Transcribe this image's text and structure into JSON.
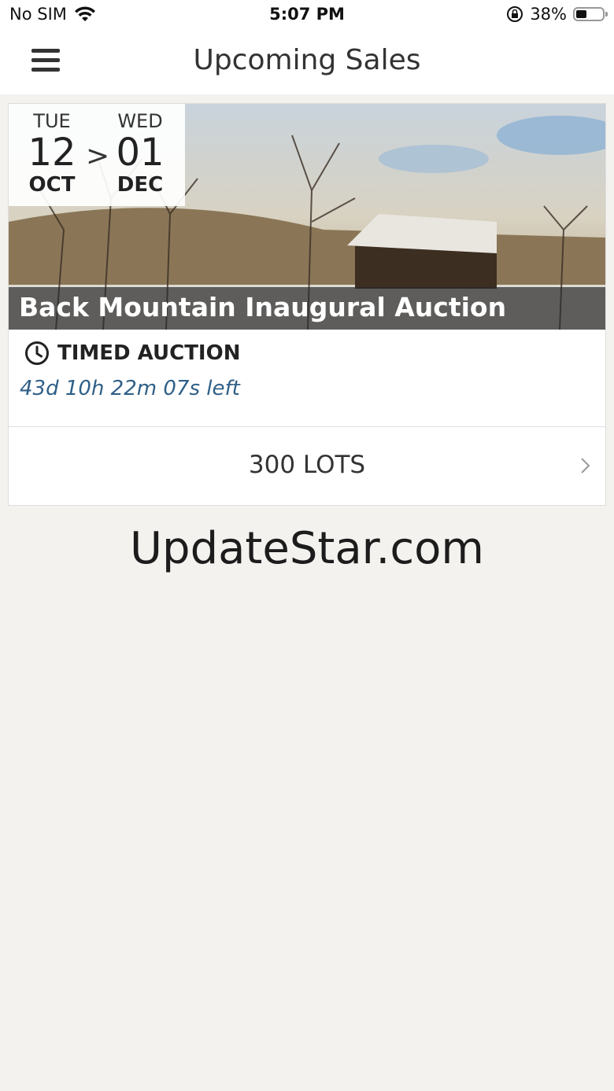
{
  "status_bar": {
    "carrier": "No SIM",
    "time": "5:07 PM",
    "battery_percent": "38%",
    "battery_level": 0.38
  },
  "nav": {
    "title": "Upcoming Sales",
    "menu_icon": "hamburger-menu-icon"
  },
  "sale": {
    "start": {
      "dow": "TUE",
      "day": "12",
      "month": "OCT"
    },
    "separator": ">",
    "end": {
      "dow": "WED",
      "day": "01",
      "month": "DEC"
    },
    "title": "Back Mountain Inaugural Auction",
    "type_label": "TIMED AUCTION",
    "type_icon": "clock-icon",
    "time_left": "43d 10h 22m 07s left",
    "lots_label": "300 LOTS",
    "lots_icon": "chevron-right-icon"
  },
  "watermark": "UpdateStar.com",
  "colors": {
    "background": "#f3f2ef",
    "time_left": "#2f5f87",
    "title_strip": "#282828"
  }
}
